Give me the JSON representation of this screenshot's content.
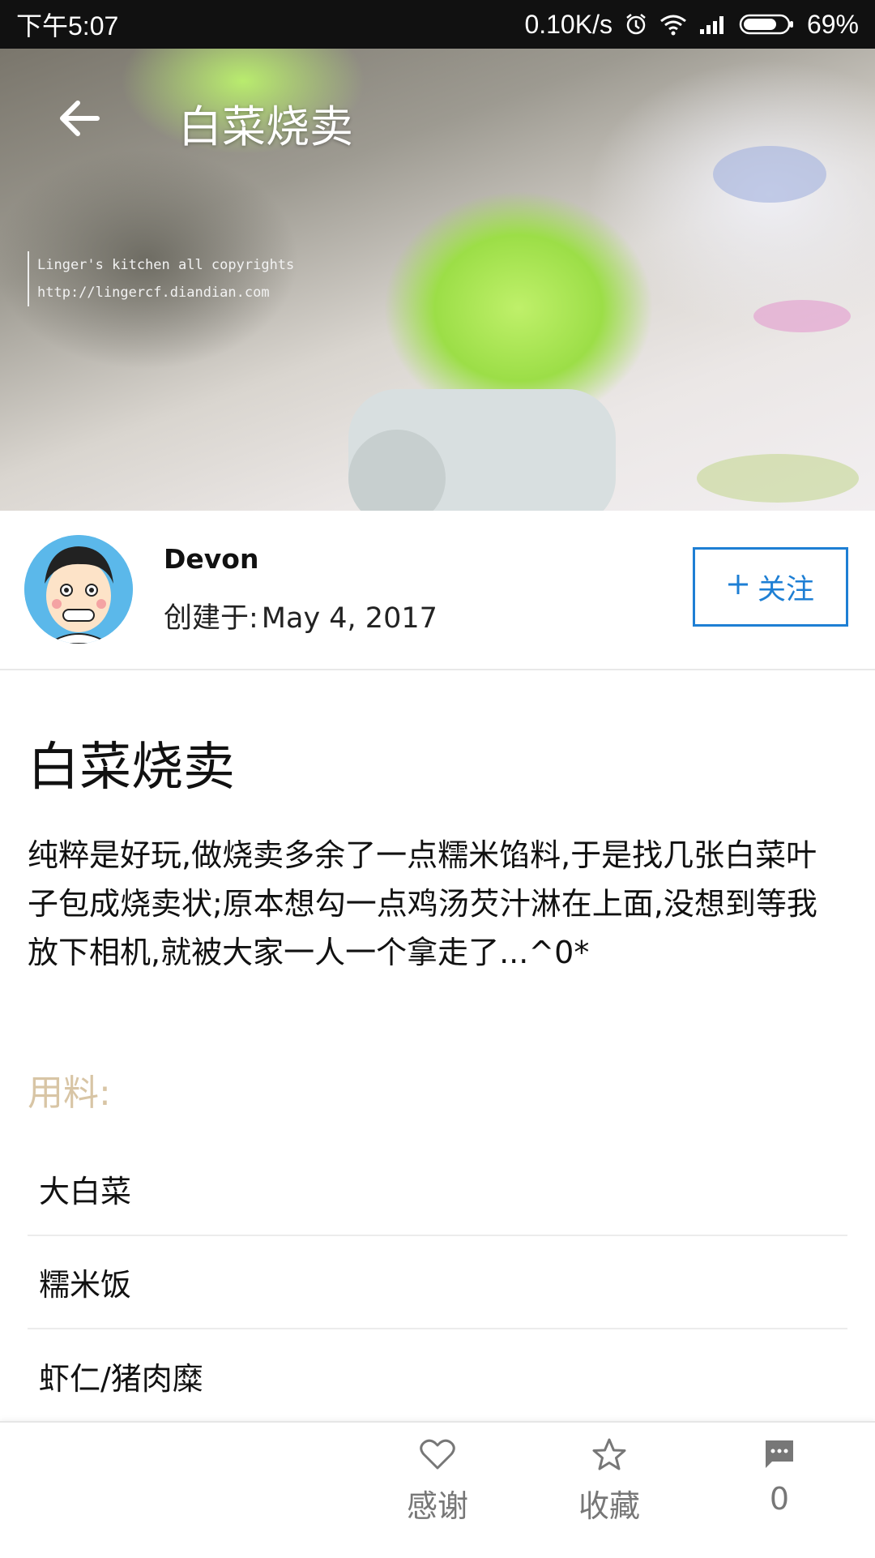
{
  "status_bar": {
    "time": "下午5:07",
    "speed": "0.10K/s",
    "battery": "69%"
  },
  "hero": {
    "title": "白菜烧卖",
    "watermark_line1": "Linger's kitchen all copyrights",
    "watermark_line2": "http://lingercf.diandian.com"
  },
  "author": {
    "name": "Devon",
    "created_label": "创建于:",
    "created_date": "May 4, 2017",
    "follow_label": "关注"
  },
  "recipe": {
    "title": "白菜烧卖",
    "description": "纯粹是好玩,做烧卖多余了一点糯米馅料,于是找几张白菜叶子包成烧卖状;原本想勾一点鸡汤芡汁淋在上面,没想到等我放下相机,就被大家一人一个拿走了...^0*",
    "ingredients_label": "用料:",
    "ingredients": [
      "大白菜",
      "糯米饭",
      "虾仁/猪肉糜"
    ]
  },
  "bottom_bar": {
    "thanks_label": "感谢",
    "collect_label": "收藏",
    "comment_count": "0"
  },
  "colors": {
    "accent": "#1e7fd4",
    "ingredients_label": "#d8c5a5",
    "status_bar": "#111111"
  }
}
